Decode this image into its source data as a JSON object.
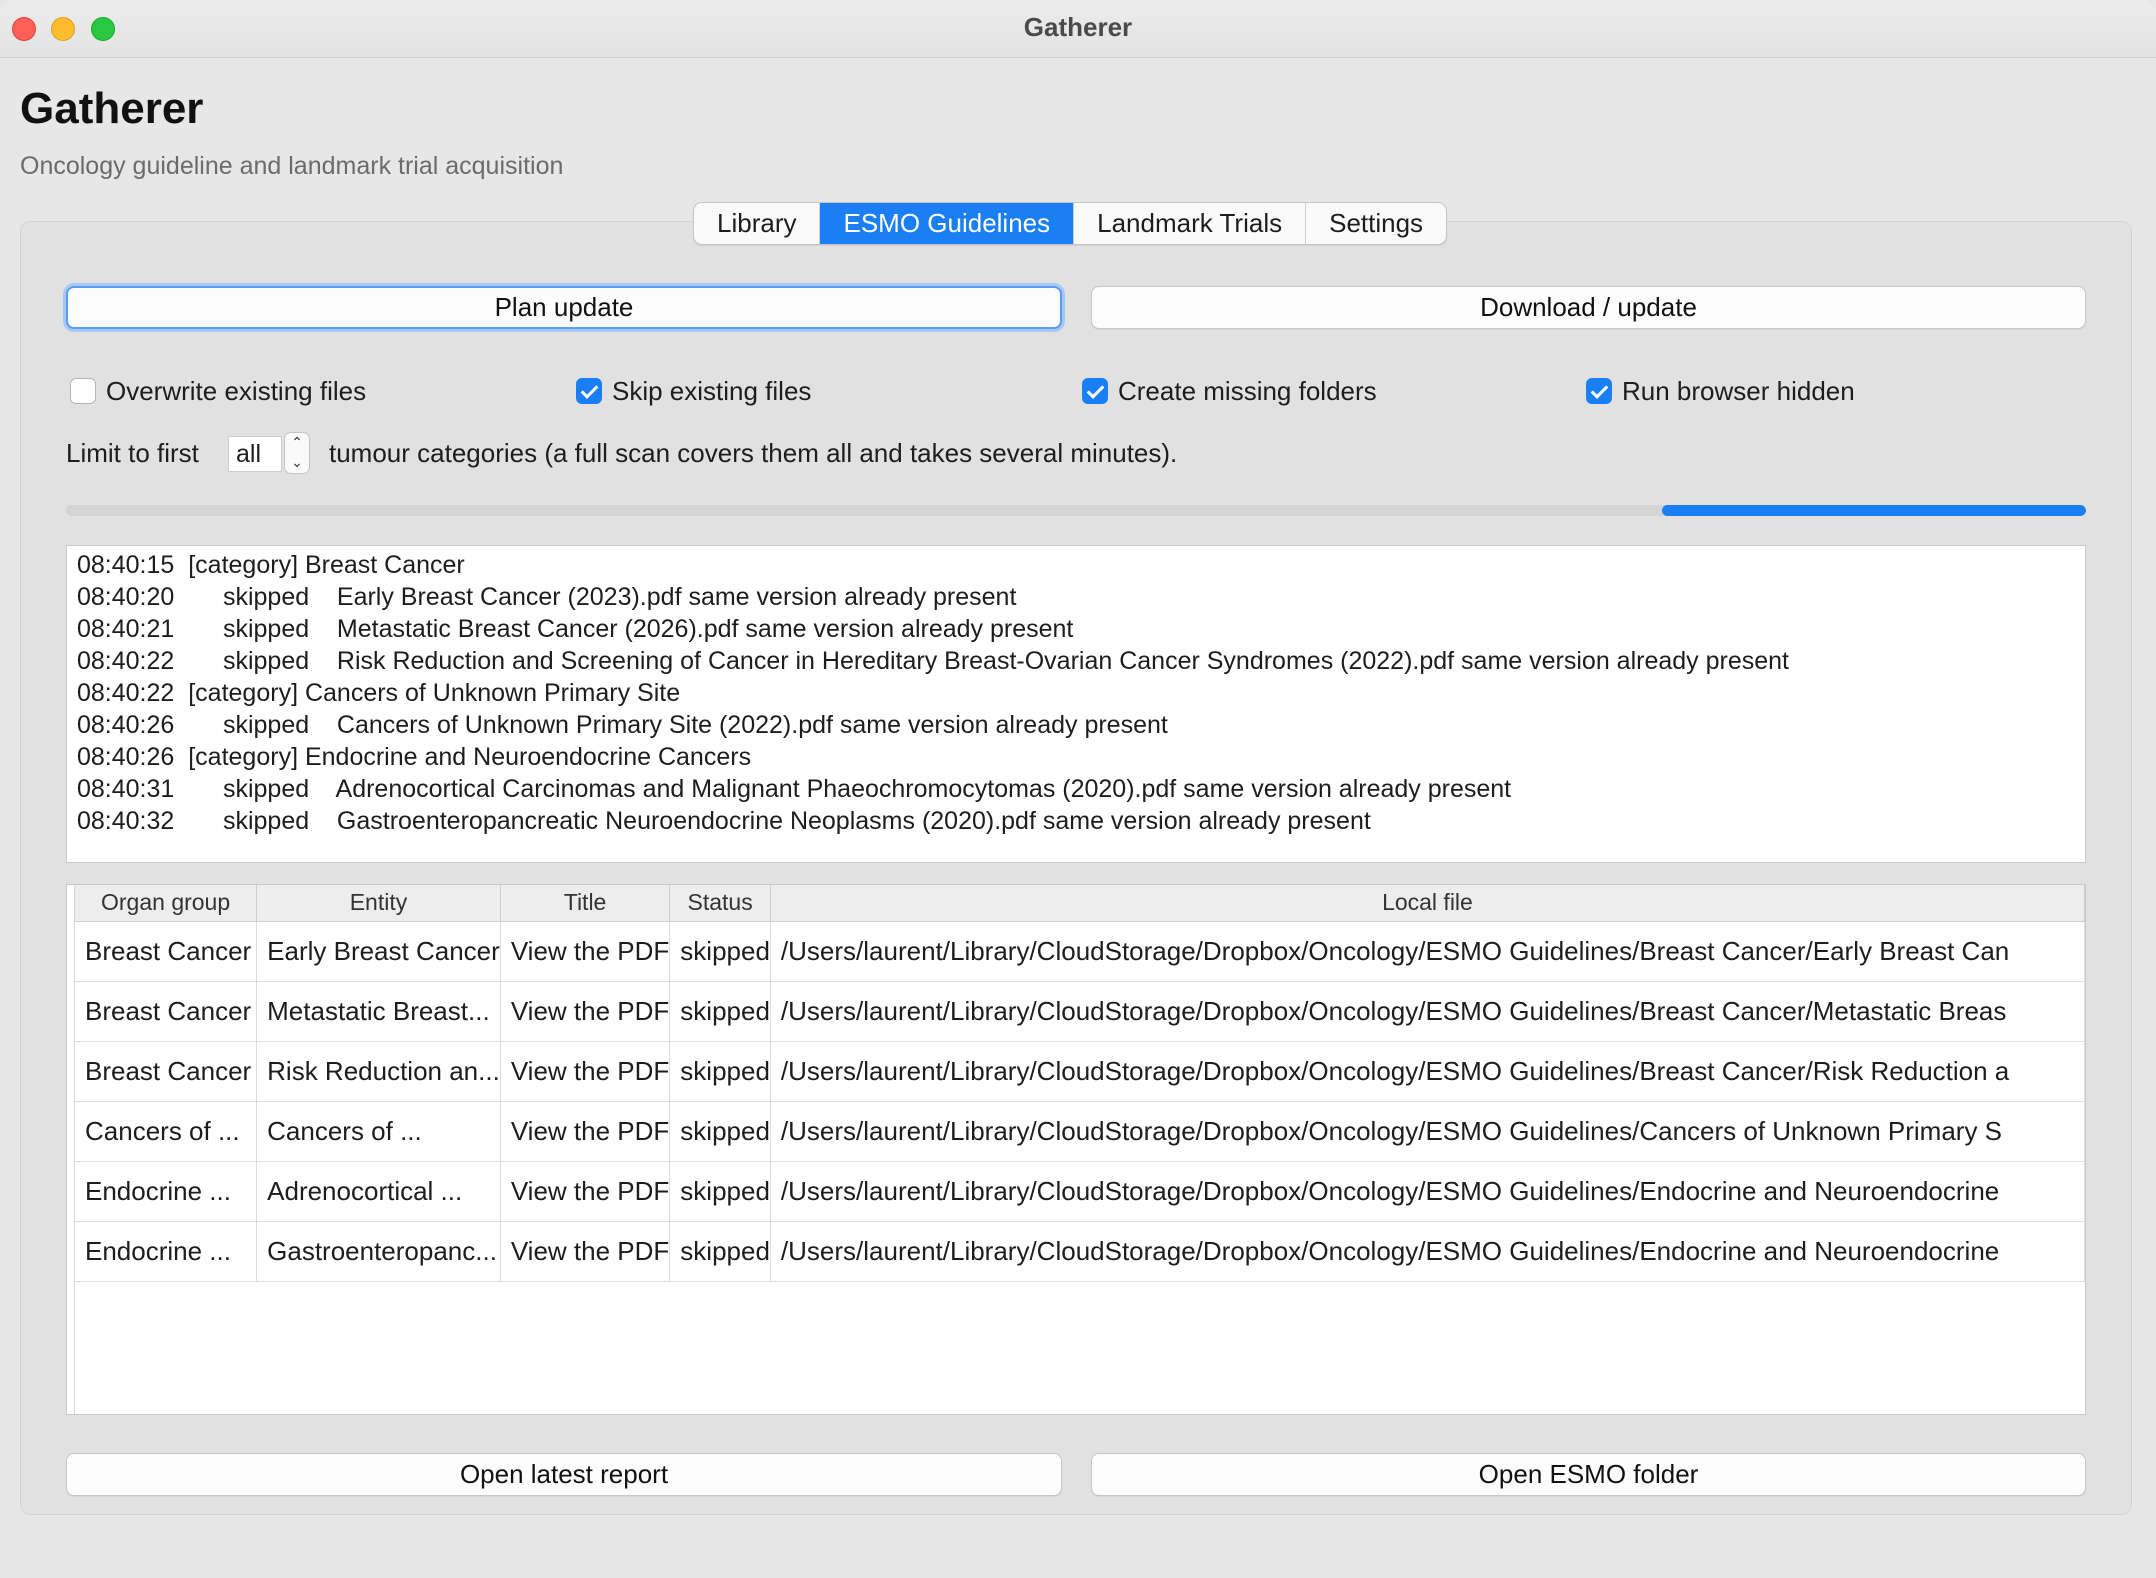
{
  "window": {
    "title": "Gatherer"
  },
  "header": {
    "title": "Gatherer",
    "subtitle": "Oncology guideline and landmark trial acquisition"
  },
  "tabs": [
    {
      "label": "Library",
      "active": false
    },
    {
      "label": "ESMO Guidelines",
      "active": true
    },
    {
      "label": "Landmark Trials",
      "active": false
    },
    {
      "label": "Settings",
      "active": false
    }
  ],
  "actions": {
    "plan_label": "Plan update",
    "download_label": "Download / update"
  },
  "options": {
    "overwrite": {
      "label": "Overwrite existing files",
      "checked": false
    },
    "skip": {
      "label": "Skip existing files",
      "checked": true
    },
    "create_folders": {
      "label": "Create missing folders",
      "checked": true
    },
    "hidden_browser": {
      "label": "Run browser hidden",
      "checked": true
    }
  },
  "limit": {
    "label": "Limit to first",
    "value": "all",
    "up_glyph": "⌃",
    "down_glyph": "⌄",
    "suffix": "tumour categories (a full scan covers them all and takes several minutes)."
  },
  "progress": {
    "start_fraction": 0.79,
    "end_fraction": 1.0
  },
  "log": [
    {
      "time": "08:40:15",
      "sep": "  ",
      "text": "[category] Breast Cancer"
    },
    {
      "time": "08:40:20",
      "sep": "       ",
      "text": "skipped    Early Breast Cancer (2023).pdf same version already present"
    },
    {
      "time": "08:40:21",
      "sep": "       ",
      "text": "skipped    Metastatic Breast Cancer (2026).pdf same version already present"
    },
    {
      "time": "08:40:22",
      "sep": "       ",
      "text": "skipped    Risk Reduction and Screening of Cancer in Hereditary Breast-Ovarian Cancer Syndromes (2022).pdf same version already present"
    },
    {
      "time": "08:40:22",
      "sep": "  ",
      "text": "[category] Cancers of Unknown Primary Site"
    },
    {
      "time": "08:40:26",
      "sep": "       ",
      "text": "skipped    Cancers of Unknown Primary Site (2022).pdf same version already present"
    },
    {
      "time": "08:40:26",
      "sep": "  ",
      "text": "[category] Endocrine and Neuroendocrine Cancers"
    },
    {
      "time": "08:40:31",
      "sep": "       ",
      "text": "skipped    Adrenocortical Carcinomas and Malignant Phaeochromocytomas (2020).pdf same version already present"
    },
    {
      "time": "08:40:32",
      "sep": "       ",
      "text": "skipped    Gastroenteropancreatic Neuroendocrine Neoplasms (2020).pdf same version already present"
    }
  ],
  "table": {
    "columns": [
      "Organ group",
      "Entity",
      "Title",
      "Status",
      "Local file"
    ],
    "rows": [
      [
        "Breast Cancer",
        "Early Breast Cancer",
        "View the PDF",
        "skipped",
        "/Users/laurent/Library/CloudStorage/Dropbox/Oncology/ESMO Guidelines/Breast Cancer/Early Breast Can"
      ],
      [
        "Breast Cancer",
        "Metastatic Breast...",
        "View the PDF",
        "skipped",
        "/Users/laurent/Library/CloudStorage/Dropbox/Oncology/ESMO Guidelines/Breast Cancer/Metastatic Breas"
      ],
      [
        "Breast Cancer",
        "Risk Reduction an...",
        "View the PDF",
        "skipped",
        "/Users/laurent/Library/CloudStorage/Dropbox/Oncology/ESMO Guidelines/Breast Cancer/Risk Reduction a"
      ],
      [
        "Cancers of ...",
        "Cancers of ...",
        "View the PDF",
        "skipped",
        "/Users/laurent/Library/CloudStorage/Dropbox/Oncology/ESMO Guidelines/Cancers of Unknown Primary S"
      ],
      [
        "Endocrine ...",
        "Adrenocortical ...",
        "View the PDF",
        "skipped",
        "/Users/laurent/Library/CloudStorage/Dropbox/Oncology/ESMO Guidelines/Endocrine and Neuroendocrine"
      ],
      [
        "Endocrine ...",
        "Gastroenteropanc...",
        "View the PDF",
        "skipped",
        "/Users/laurent/Library/CloudStorage/Dropbox/Oncology/ESMO Guidelines/Endocrine and Neuroendocrine"
      ]
    ]
  },
  "footer": {
    "report_label": "Open latest report",
    "folder_label": "Open ESMO folder"
  },
  "colors": {
    "accent": "#1a7ff5",
    "close": "#fe5f57",
    "minimize": "#febc2e",
    "maximize": "#28c840"
  }
}
